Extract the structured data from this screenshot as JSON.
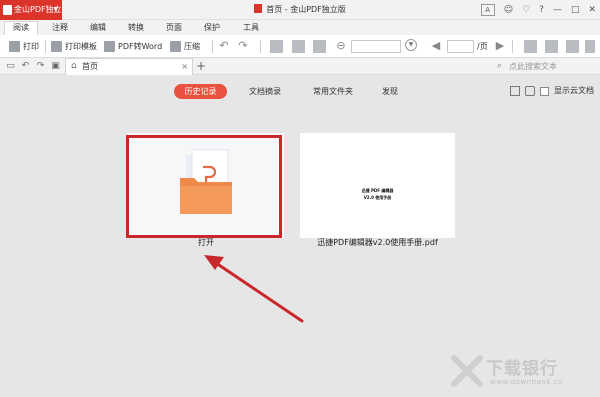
{
  "titlebar": {
    "app_name": "金山PDF独立版",
    "doc_title": "首页 - 金山PDF独立版",
    "buttons": [
      "A",
      "☺",
      "♡",
      "?",
      "—",
      "□",
      "✕"
    ]
  },
  "menu": {
    "tabs": [
      "阅读",
      "注释",
      "编辑",
      "转换",
      "页面",
      "保护",
      "工具"
    ]
  },
  "toolbar": {
    "print": "打印",
    "print_template": "打印模板",
    "pdf_to_word": "PDF转Word",
    "compress": "压缩",
    "page_suffix": "/页"
  },
  "doc_tabs": {
    "home_tab": "首页",
    "close": "×",
    "add": "+",
    "search_placeholder": "点此搜索文本"
  },
  "categories": [
    "历史记录",
    "文档摘录",
    "常用文件夹",
    "发现"
  ],
  "cloud": {
    "label": "显示云文档"
  },
  "files": [
    {
      "name": "打开",
      "highlighted": true
    },
    {
      "name": "迅捷PDF编辑器v2.0使用手册.pdf",
      "preview_lines": [
        "迅捷 PDF 编辑器",
        "V2.0 使用手册"
      ]
    }
  ],
  "watermark": {
    "title": "下载银行",
    "url": "www.downbank.cn"
  },
  "colors": {
    "brand_red": "#d9352b",
    "category_active": "#e8523f",
    "highlight_border": "#c9272a",
    "folder_orange": "#f08a4b"
  }
}
